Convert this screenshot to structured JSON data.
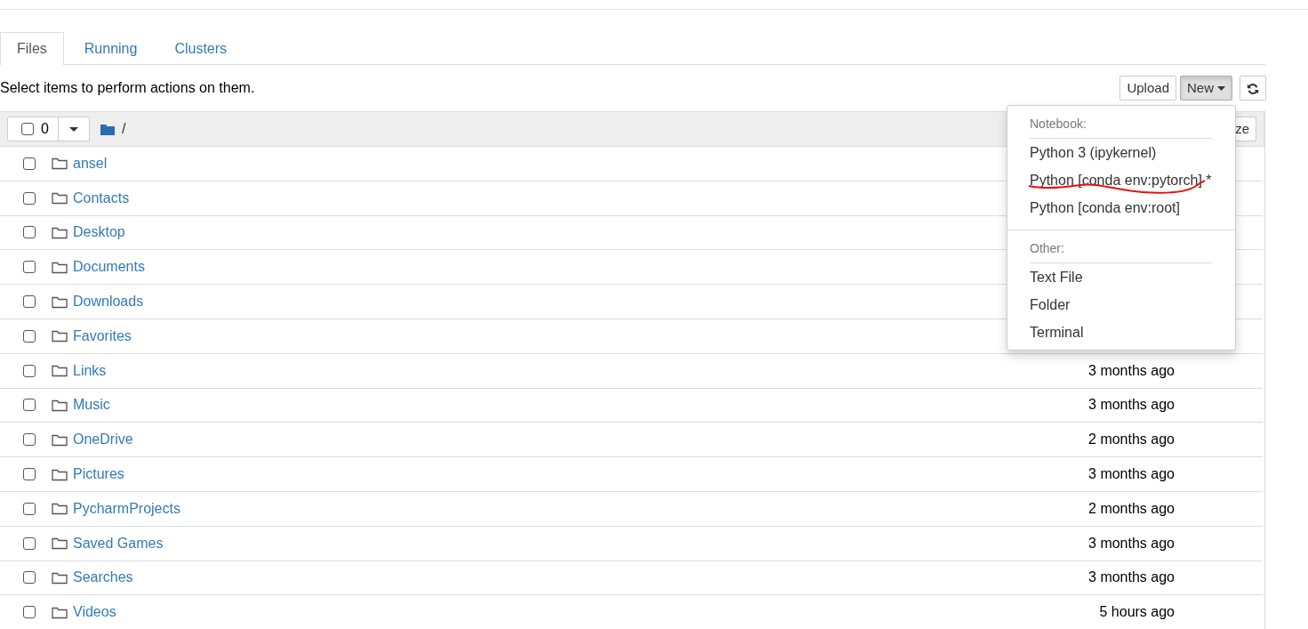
{
  "tabs": [
    {
      "label": "Files",
      "selected": true
    },
    {
      "label": "Running",
      "selected": false
    },
    {
      "label": "Clusters",
      "selected": false
    }
  ],
  "hint": "Select items to perform actions on them.",
  "buttons": {
    "upload": "Upload",
    "new": "New"
  },
  "header": {
    "count": "0",
    "checked": false,
    "path": "/",
    "sort_button": "ze"
  },
  "rows": [
    {
      "name": "ansel",
      "checked": false
    },
    {
      "name": "Contacts",
      "checked": false
    },
    {
      "name": "Desktop",
      "checked": false
    },
    {
      "name": "Documents",
      "checked": false
    },
    {
      "name": "Downloads",
      "checked": false
    },
    {
      "name": "Favorites",
      "checked": false
    },
    {
      "name": "Links",
      "checked": false,
      "modified": "3 months ago"
    },
    {
      "name": "Music",
      "checked": false,
      "modified": "3 months ago"
    },
    {
      "name": "OneDrive",
      "checked": false,
      "modified": "2 months ago"
    },
    {
      "name": "Pictures",
      "checked": false,
      "modified": "3 months ago"
    },
    {
      "name": "PycharmProjects",
      "checked": false,
      "modified": "2 months ago"
    },
    {
      "name": "Saved Games",
      "checked": false,
      "modified": "3 months ago"
    },
    {
      "name": "Searches",
      "checked": false,
      "modified": "3 months ago"
    },
    {
      "name": "Videos",
      "checked": false,
      "modified": "5 hours ago"
    }
  ],
  "menu": [
    {
      "kind": "header",
      "label": "Notebook:"
    },
    {
      "kind": "item",
      "label": "Python 3 (ipykernel)"
    },
    {
      "kind": "item",
      "label": "Python [conda env:pytorch] *"
    },
    {
      "kind": "item",
      "label": "Python [conda env:root]"
    },
    {
      "kind": "divider"
    },
    {
      "kind": "header",
      "label": "Other:"
    },
    {
      "kind": "item",
      "label": "Text File"
    },
    {
      "kind": "item",
      "label": "Folder"
    },
    {
      "kind": "item",
      "label": "Terminal"
    }
  ]
}
